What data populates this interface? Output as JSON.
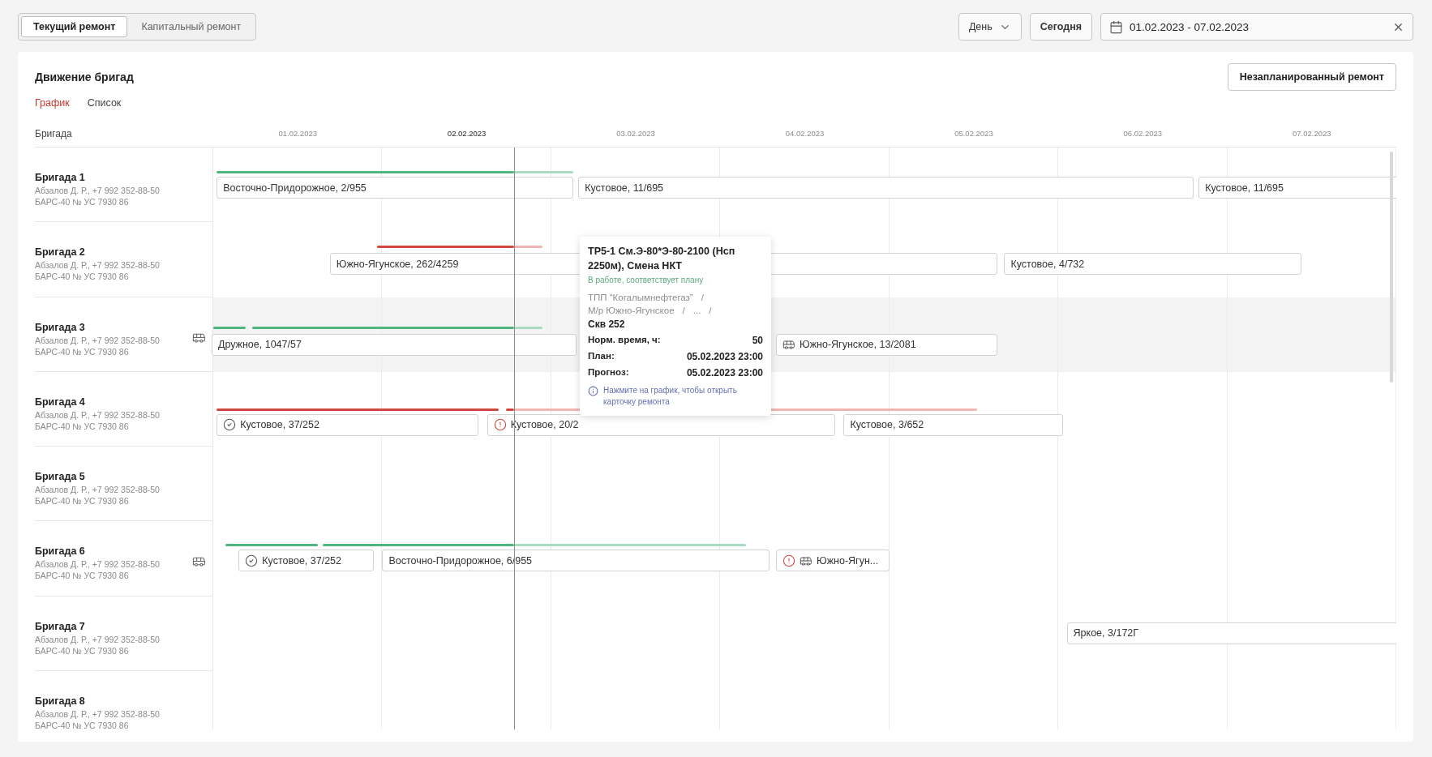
{
  "repair_tabs": [
    {
      "label": "Текущий ремонт",
      "selected": true
    },
    {
      "label": "Капитальный ремонт",
      "selected": false
    }
  ],
  "toolbar": {
    "scale": "День",
    "today_button": "Сегодня",
    "date_range": "01.02.2023 - 07.02.2023"
  },
  "panel": {
    "title": "Движение бригад",
    "action_button": "Незапланированный ремонт",
    "view_tabs": [
      {
        "label": "График",
        "selected": true
      },
      {
        "label": "Список",
        "selected": false
      }
    ],
    "column_header": "Бригада",
    "days": [
      {
        "label": "01.02.2023",
        "today": false
      },
      {
        "label": "02.02.2023",
        "today": true
      },
      {
        "label": "03.02.2023",
        "today": false
      },
      {
        "label": "04.02.2023",
        "today": false
      },
      {
        "label": "05.02.2023",
        "today": false
      },
      {
        "label": "06.02.2023",
        "today": false
      },
      {
        "label": "07.02.2023",
        "today": false
      }
    ],
    "crews": [
      {
        "name": "Бригада 1",
        "person": "Абзалов Д. Р., +7 992 352-88-50",
        "vehicle": "БАРС-40 № УС 7930 86",
        "transport": false,
        "highlighted": false,
        "bar": {
          "delayed": false
        },
        "tasks": [
          {
            "label": "Восточно-Придорожное, 2/955",
            "kind": "plain",
            "transport": false
          },
          {
            "label": "Кустовое, 11/695",
            "kind": "plain",
            "transport": false
          },
          {
            "label": "Кустовое, 11/695",
            "kind": "plain",
            "transport": false
          }
        ]
      },
      {
        "name": "Бригада 2",
        "person": "Абзалов Д. Р., +7 992 352-88-50",
        "vehicle": "БАРС-40 № УС 7930 86",
        "transport": false,
        "highlighted": false,
        "bar": {
          "delayed": true
        },
        "tasks": [
          {
            "label": "Южно-Ягунское, 262/4259",
            "kind": "plain",
            "transport": false
          },
          {
            "label": "Кустовое, 4/732",
            "kind": "plain",
            "transport": false
          }
        ]
      },
      {
        "name": "Бригада 3",
        "person": "Абзалов Д. Р., +7 992 352-88-50",
        "vehicle": "БАРС-40 № УС 7930 86",
        "transport": true,
        "highlighted": true,
        "bar": {
          "delayed": false
        },
        "tasks": [
          {
            "label": "Дружное, 1047/57",
            "kind": "plain",
            "transport": false
          },
          {
            "label": "Южно-Ягунское, 13/2081",
            "kind": "plain",
            "transport": true
          }
        ]
      },
      {
        "name": "Бригада 4",
        "person": "Абзалов Д. Р., +7 992 352-88-50",
        "vehicle": "БАРС-40 № УС 7930 86",
        "transport": false,
        "highlighted": false,
        "bar": {
          "delayed": true
        },
        "tasks": [
          {
            "label": "Кустовое, 37/252",
            "kind": "done",
            "transport": false
          },
          {
            "label": "Кустовое, 20/2",
            "kind": "alert",
            "transport": false
          },
          {
            "label": "Кустовое, 3/652",
            "kind": "plain",
            "transport": false
          }
        ]
      },
      {
        "name": "Бригада 5",
        "person": "Абзалов Д. Р., +7 992 352-88-50",
        "vehicle": "БАРС-40 № УС 7930 86",
        "transport": false,
        "highlighted": false
      },
      {
        "name": "Бригада 6",
        "person": "Абзалов Д. Р., +7 992 352-88-50",
        "vehicle": "БАРС-40 № УС 7930 86",
        "transport": true,
        "highlighted": false,
        "bar": {
          "delayed": false
        },
        "tasks": [
          {
            "label": "Кустовое, 37/252",
            "kind": "done",
            "transport": false
          },
          {
            "label": "Восточно-Придорожное, 6/955",
            "kind": "plain",
            "transport": false
          },
          {
            "label": "Южно-Ягун...",
            "kind": "alert",
            "transport": true
          }
        ]
      },
      {
        "name": "Бригада 7",
        "person": "Абзалов Д. Р., +7 992 352-88-50",
        "vehicle": "БАРС-40 № УС 7930 86",
        "transport": false,
        "highlighted": false,
        "tasks": [
          {
            "label": "Яркое, 3/172Г",
            "kind": "plain",
            "transport": false
          }
        ]
      },
      {
        "name": "Бригада 8",
        "person": "Абзалов Д. Р., +7 992 352-88-50",
        "vehicle": "БАРС-40 № УС 7930 86",
        "transport": false,
        "highlighted": false
      }
    ],
    "tooltip": {
      "title": "ТР5-1 См.Э-80*Э-80-2100 (Нсп 2250м), Смена НКТ",
      "status": "В работе, соответствует плану",
      "path": [
        "ТПП “Когалымнефтегаз”",
        "М/р Южно-Ягунское",
        "..."
      ],
      "path_separator": "/",
      "well": "Скв 252",
      "fields": [
        {
          "label": "Норм. время, ч:",
          "value": "50"
        },
        {
          "label": "План:",
          "value": "05.02.2023 23:00"
        },
        {
          "label": "Прогноз:",
          "value": "05.02.2023 23:00"
        }
      ],
      "hint": "Нажмите на график, чтобы открыть карточку ремонта"
    }
  }
}
